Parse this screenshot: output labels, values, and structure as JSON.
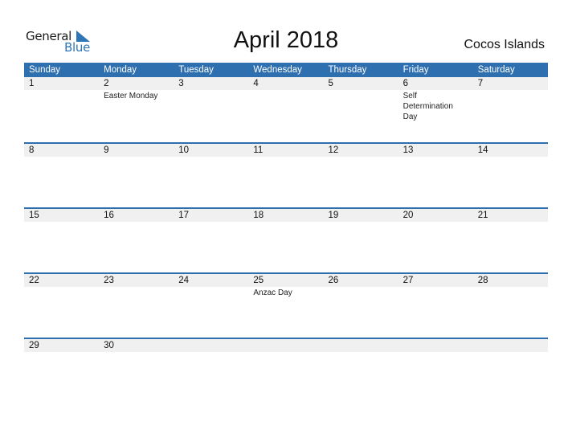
{
  "logo": {
    "general": "General",
    "blue": "Blue"
  },
  "title": "April 2018",
  "country": "Cocos Islands",
  "colors": {
    "header_bg": "#2e6faf",
    "date_row_bg": "#f0f0f0",
    "logo_blue": "#2e75b6"
  },
  "weekdays": [
    "Sunday",
    "Monday",
    "Tuesday",
    "Wednesday",
    "Thursday",
    "Friday",
    "Saturday"
  ],
  "weeks": [
    {
      "days": [
        "1",
        "2",
        "3",
        "4",
        "5",
        "6",
        "7"
      ],
      "events": [
        "",
        "Easter Monday",
        "",
        "",
        "",
        "Self Determination Day",
        ""
      ]
    },
    {
      "days": [
        "8",
        "9",
        "10",
        "11",
        "12",
        "13",
        "14"
      ],
      "events": [
        "",
        "",
        "",
        "",
        "",
        "",
        ""
      ]
    },
    {
      "days": [
        "15",
        "16",
        "17",
        "18",
        "19",
        "20",
        "21"
      ],
      "events": [
        "",
        "",
        "",
        "",
        "",
        "",
        ""
      ]
    },
    {
      "days": [
        "22",
        "23",
        "24",
        "25",
        "26",
        "27",
        "28"
      ],
      "events": [
        "",
        "",
        "",
        "Anzac Day",
        "",
        "",
        ""
      ]
    },
    {
      "days": [
        "29",
        "30",
        "",
        "",
        "",
        "",
        ""
      ],
      "events": [
        "",
        "",
        "",
        "",
        "",
        "",
        ""
      ]
    }
  ]
}
